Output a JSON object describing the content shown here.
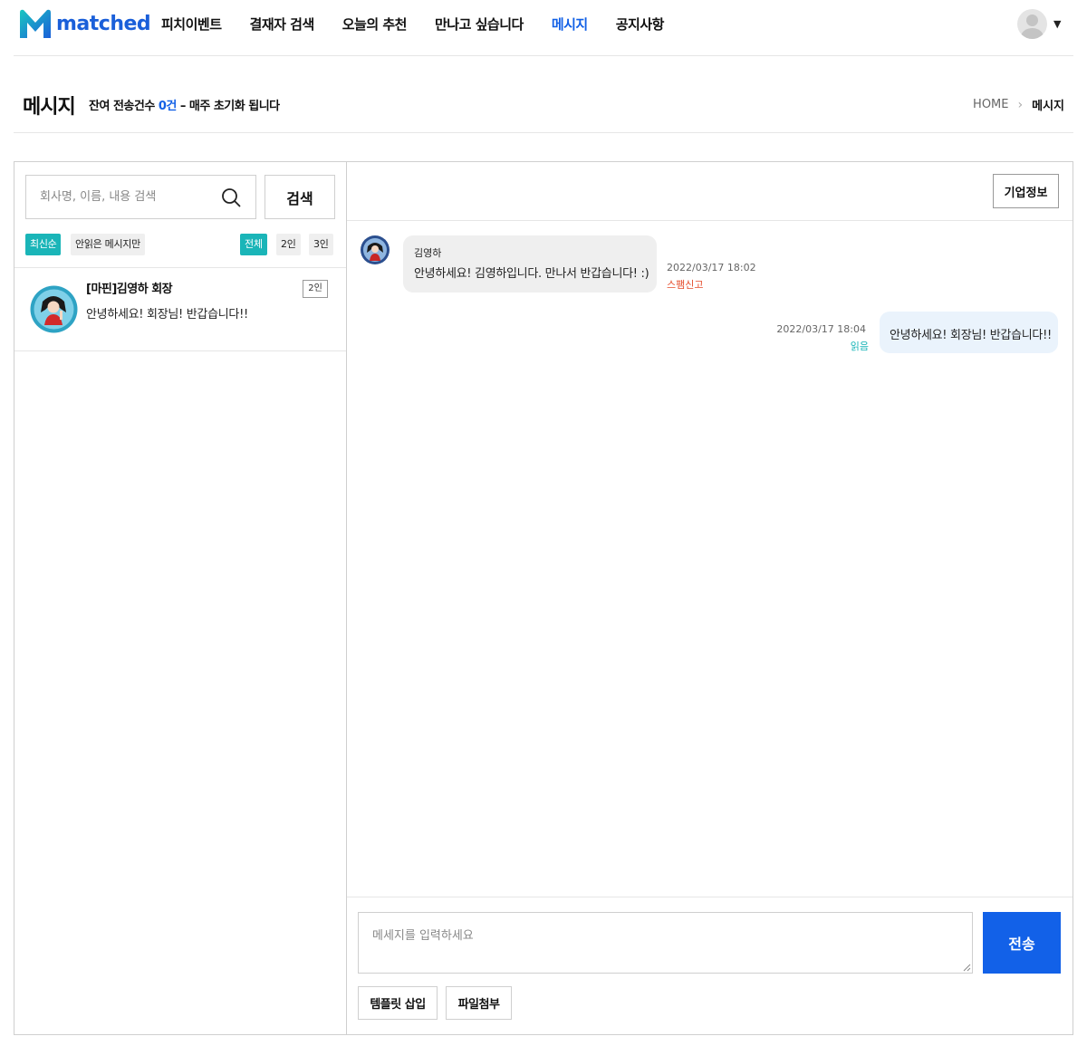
{
  "header": {
    "logo_text": "matched",
    "nav": [
      {
        "label": "피치이벤트"
      },
      {
        "label": "결재자 검색"
      },
      {
        "label": "오늘의 추천"
      },
      {
        "label": "만나고 싶습니다"
      },
      {
        "label": "메시지",
        "active": true
      },
      {
        "label": "공지사항"
      }
    ],
    "brand_color": "#1a5fd9",
    "accent_color": "#1260e6"
  },
  "page": {
    "title": "메시지",
    "quota_prefix": "잔여 전송건수",
    "quota_count": "0건",
    "quota_suffix": "– 매주 초기화 됩니다",
    "breadcrumb": {
      "home": "HOME",
      "current": "메시지"
    }
  },
  "sidebar": {
    "search_placeholder": "회사명, 이름, 내용 검색",
    "search_button": "검색",
    "sort_chips": [
      {
        "label": "최신순",
        "active": true
      },
      {
        "label": "안읽은 메시지만",
        "active": false
      }
    ],
    "size_chips": [
      {
        "label": "전체",
        "active": true
      },
      {
        "label": "2인",
        "active": false
      },
      {
        "label": "3인",
        "active": false
      }
    ],
    "conversations": [
      {
        "name": "[마핀]김영하 회장",
        "badge": "2인",
        "last_message": "안녕하세요! 회장님! 반갑습니다!!"
      }
    ]
  },
  "chat": {
    "company_info_button": "기업정보",
    "messages": [
      {
        "direction": "in",
        "sender": "김영하",
        "text": "안녕하세요! 김영하입니다. 만나서 반갑습니다! :)",
        "time": "2022/03/17 18:02",
        "action": "스팸신고"
      },
      {
        "direction": "out",
        "text": "안녕하세요! 회장님! 반갑습니다!!",
        "time": "2022/03/17 18:04",
        "status": "읽음"
      }
    ],
    "compose_placeholder": "메세지를 입력하세요",
    "send_button": "전송",
    "template_button": "템플릿 삽입",
    "attach_button": "파일첨부"
  },
  "colors": {
    "chip_active": "#1ab5b8",
    "spam": "#e54b2a",
    "read": "#1ab5b8",
    "send": "#1261e8"
  }
}
